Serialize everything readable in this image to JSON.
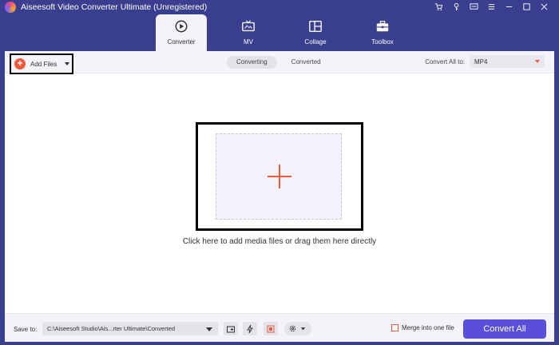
{
  "window": {
    "title": "Aiseesoft Video Converter Ultimate (Unregistered)",
    "icons": [
      "cart-icon",
      "key-icon",
      "chat-icon",
      "menu-icon",
      "minimize-icon",
      "maximize-icon",
      "close-icon"
    ]
  },
  "tabs": [
    {
      "label": "Converter",
      "icon": "converter-icon",
      "active": true
    },
    {
      "label": "MV",
      "icon": "tv-icon",
      "active": false
    },
    {
      "label": "Collage",
      "icon": "collage-icon",
      "active": false
    },
    {
      "label": "Toolbox",
      "icon": "toolbox-icon",
      "active": false
    }
  ],
  "toolbar": {
    "add_files_label": "Add Files",
    "segments": [
      {
        "label": "Converting",
        "active": true
      },
      {
        "label": "Converted",
        "active": false
      }
    ],
    "convert_all_to_label": "Convert All to:",
    "format_value": "MP4"
  },
  "drop_area": {
    "hint": "Click here to add media files or drag them here directly"
  },
  "bottom": {
    "save_to_label": "Save to:",
    "save_path": "C:\\Aiseesoft Studio\\Ais...rter Ultimate\\Converted",
    "merge_label": "Merge into one file",
    "merge_checked": false,
    "convert_all_label": "Convert All"
  },
  "colors": {
    "chrome": "#3a3e8e",
    "accent": "#f05a3a",
    "primary_button": "#5a4fd8"
  }
}
